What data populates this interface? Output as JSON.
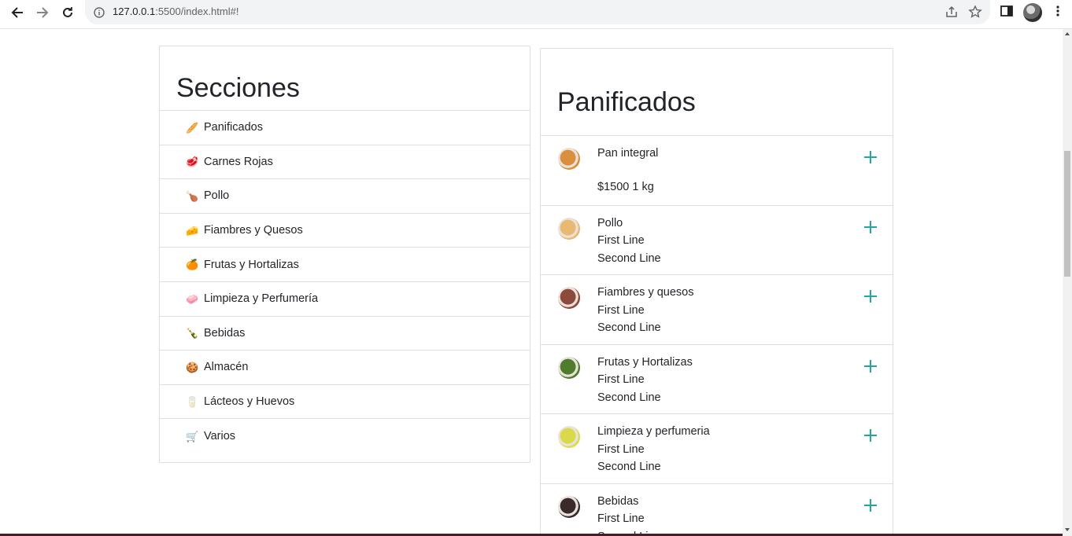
{
  "browser": {
    "url_host": "127.0.0.1",
    "url_rest": ":5500/index.html#!"
  },
  "sections": {
    "title": "Secciones",
    "items": [
      {
        "label": "Panificados",
        "icon": "bread-icon",
        "glyph": "🥖",
        "color": "#e8a25a"
      },
      {
        "label": "Carnes Rojas",
        "icon": "meat-icon",
        "glyph": "🥩",
        "color": "#c0392b"
      },
      {
        "label": "Pollo",
        "icon": "poultry-leg-icon",
        "glyph": "🍗",
        "color": "#b5651d"
      },
      {
        "label": "Fiambres y Quesos",
        "icon": "cheese-icon",
        "glyph": "🧀",
        "color": "#f4c430"
      },
      {
        "label": "Frutas y Hortalizas",
        "icon": "orange-icon",
        "glyph": "🍊",
        "color": "#f57c00"
      },
      {
        "label": "Limpieza y Perfumería",
        "icon": "soap-icon",
        "glyph": "🧼",
        "color": "#e86fb3"
      },
      {
        "label": "Bebidas",
        "icon": "bottle-icon",
        "glyph": "🍾",
        "color": "#4caf50"
      },
      {
        "label": "Almacén",
        "icon": "cookie-icon",
        "glyph": "🍪",
        "color": "#c68642"
      },
      {
        "label": "Lácteos y Huevos",
        "icon": "glass-icon",
        "glyph": "🥛",
        "color": "#90caf9"
      },
      {
        "label": "Varios",
        "icon": "cart-icon",
        "glyph": "🛒",
        "color": "#607d8b"
      }
    ]
  },
  "products": {
    "title": "Panificados",
    "items": [
      {
        "title": "Pan integral",
        "line1": "",
        "line2": "",
        "price": "$1500 1 kg",
        "avatar": "bread-avatar",
        "color": "#d98f3e"
      },
      {
        "title": "Pollo",
        "line1": "First Line",
        "line2": "Second Line",
        "price": "",
        "avatar": "chicken-avatar",
        "color": "#e9b872"
      },
      {
        "title": "Fiambres y quesos",
        "line1": "First Line",
        "line2": "Second Line",
        "price": "",
        "avatar": "cold-cuts-avatar",
        "color": "#8b4a3a"
      },
      {
        "title": "Frutas y Hortalizas",
        "line1": "First Line",
        "line2": "Second Line",
        "price": "",
        "avatar": "vegetables-avatar",
        "color": "#4f7d2c"
      },
      {
        "title": "Limpieza y perfumeria",
        "line1": "First Line",
        "line2": "Second Line",
        "price": "",
        "avatar": "sponge-avatar",
        "color": "#d9d94a"
      },
      {
        "title": "Bebidas",
        "line1": "First Line",
        "line2": "Second Line",
        "price": "",
        "avatar": "drinks-avatar",
        "color": "#3a2a2a"
      }
    ]
  },
  "accent": "#26a69a"
}
